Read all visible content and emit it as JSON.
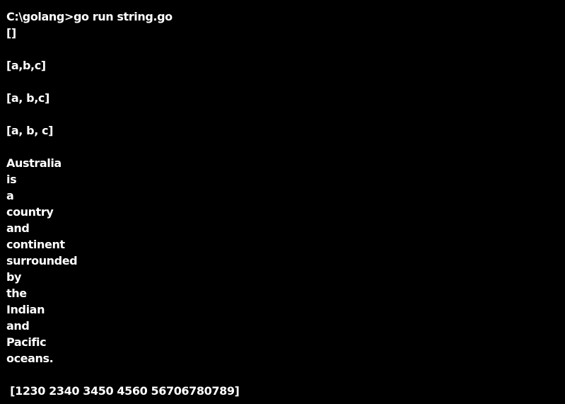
{
  "terminal": {
    "lines": [
      "C:\\golang>go run string.go",
      "[]",
      "",
      "[a,b,c]",
      "",
      "[a, b,c]",
      "",
      "[a, b, c]",
      "",
      "Australia",
      "is",
      "a",
      "country",
      "and",
      "continent",
      "surrounded",
      "by",
      "the",
      "Indian",
      "and",
      "Pacific",
      "oceans.",
      "",
      " [1230 2340 3450 4560 56706780789]"
    ]
  },
  "colors": {
    "background": "#000000",
    "text": "#ffffff"
  }
}
